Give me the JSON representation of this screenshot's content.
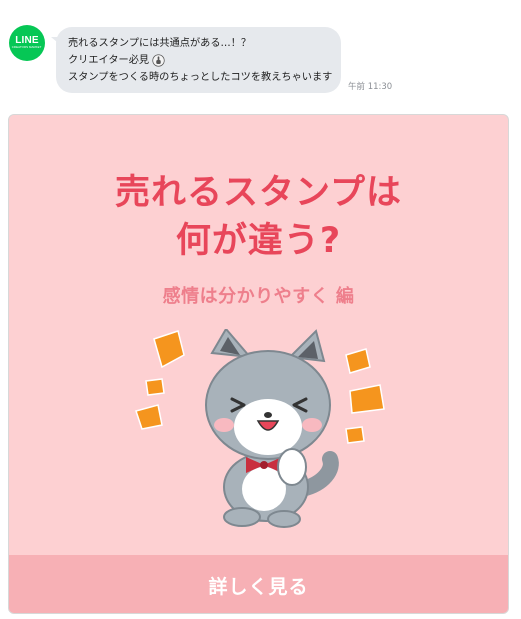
{
  "message": {
    "sender_logo": {
      "main": "LINE",
      "sub": "CREATORS MARKET"
    },
    "lines": [
      "売れるスタンプには共通点がある…！？",
      "クリエイター必見",
      "スタンプをつくる時のちょっとしたコツを教えちゃいます"
    ],
    "timestamp": "午前 11:30"
  },
  "card": {
    "title_line1": "売れるスタンプは",
    "title_line2": "何が違う?",
    "subtitle": "感情は分かりやすく 編",
    "button_label": "詳しく見る",
    "colors": {
      "background": "#fdd0d2",
      "title": "#e8465a",
      "subtitle": "#ee7f8c",
      "button": "#f7b0b5",
      "accent_marks": "#f5951e"
    }
  }
}
